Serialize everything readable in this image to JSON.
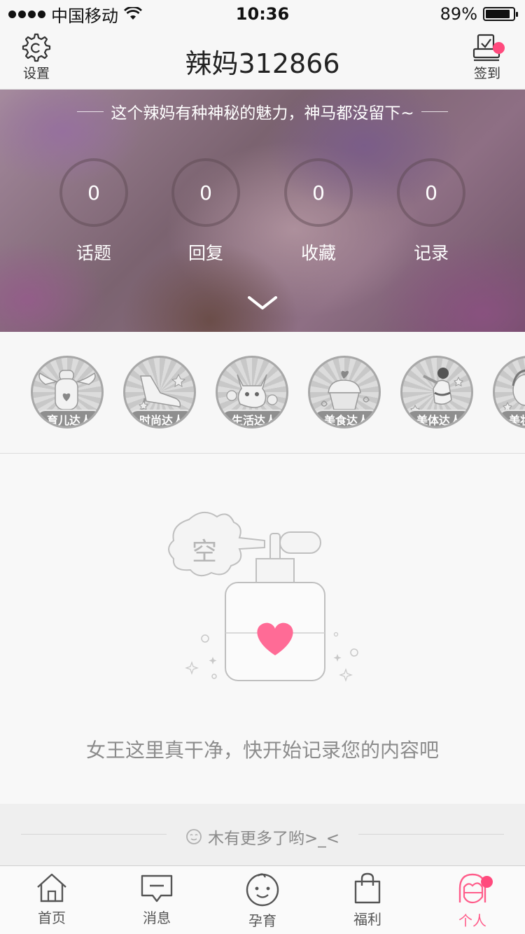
{
  "status_bar": {
    "carrier": "中国移动",
    "time": "10:36",
    "battery_percent": "89%",
    "battery_level": 0.89
  },
  "nav": {
    "settings_label": "设置",
    "title": "辣妈312866",
    "checkin_label": "签到",
    "settings_icon": "gear-icon",
    "checkin_icon": "checkin-icon"
  },
  "profile": {
    "bio": "这个辣妈有种神秘的魅力，神马都没留下~",
    "stats": [
      {
        "value": "0",
        "label": "话题"
      },
      {
        "value": "0",
        "label": "回复"
      },
      {
        "value": "0",
        "label": "收藏"
      },
      {
        "value": "0",
        "label": "记录"
      }
    ]
  },
  "badges": [
    {
      "label": "育儿达人",
      "icon": "baby-bottle-icon"
    },
    {
      "label": "时尚达人",
      "icon": "high-heel-icon"
    },
    {
      "label": "生活达人",
      "icon": "cat-icon"
    },
    {
      "label": "美食达人",
      "icon": "cupcake-icon"
    },
    {
      "label": "美体达人",
      "icon": "fitness-woman-icon"
    },
    {
      "label": "美妆达人",
      "icon": "makeup-woman-icon"
    }
  ],
  "empty": {
    "bubble_text": "空",
    "message": "女王这里真干净，快开始记录您的内容吧"
  },
  "footer": {
    "no_more": "木有更多了哟>_<"
  },
  "tabbar": {
    "tabs": [
      {
        "label": "首页",
        "icon": "home-icon"
      },
      {
        "label": "消息",
        "icon": "message-icon"
      },
      {
        "label": "孕育",
        "icon": "baby-face-icon"
      },
      {
        "label": "福利",
        "icon": "shopping-bag-icon"
      },
      {
        "label": "个人",
        "icon": "profile-icon"
      }
    ],
    "active_index": 4
  },
  "colors": {
    "accent": "#ff5c8a",
    "badge_dot": "#ff4a7d",
    "heart": "#ff6b96"
  }
}
